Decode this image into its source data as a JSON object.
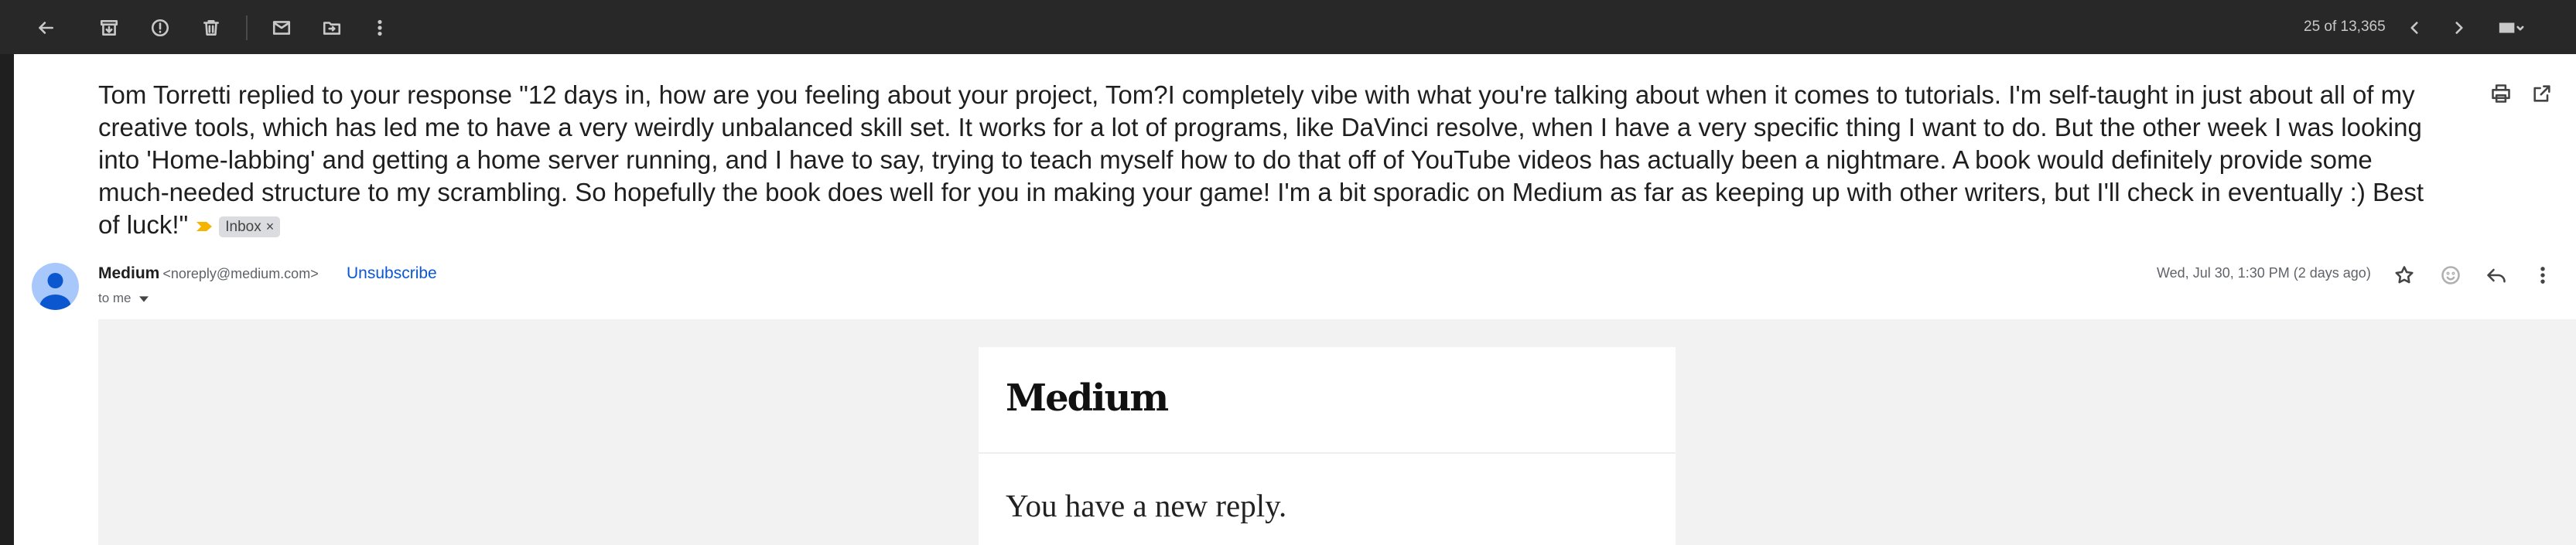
{
  "toolbar": {
    "icons": [
      "back-arrow-icon",
      "archive-icon",
      "report-spam-icon",
      "delete-icon",
      "mark-unread-icon",
      "move-to-icon",
      "more-vert-icon"
    ],
    "counter": "25 of 13,365",
    "nav_icons": [
      "chevron-left-icon",
      "chevron-right-icon",
      "keyboard-icon"
    ]
  },
  "email": {
    "subject": "Tom Torretti replied to your response \"12 days in, how are you feeling about your project, Tom?I completely vibe with what you're talking about when it comes to tutorials. I'm self-taught in just about all of my creative tools, which has led me to have a very weirdly unbalanced skill set. It works for a lot of programs, like DaVinci resolve, when I have a very specific thing I want to do. But the other week I was looking into 'Home-labbing' and getting a home server running, and I have to say, trying to teach myself how to do that off of YouTube videos has actually been a nightmare. A book would definitely provide some much-needed structure to my scrambling. So hopefully the book does well for you in making your game! I'm a bit sporadic on Medium as far as keeping up with other writers, but I'll check in eventually :) Best of luck!\"",
    "label": "Inbox",
    "label_close": "×",
    "sender_name": "Medium",
    "sender_email": "<noreply@medium.com>",
    "unsubscribe": "Unsubscribe",
    "to": "to me",
    "date": "Wed, Jul 30, 1:30 PM (2 days ago)",
    "colors": {
      "important": "#f4b400",
      "link": "#0b57d0",
      "avatar": "#a8c7fa"
    }
  },
  "message_body": {
    "logo": "Medium",
    "heading": "You have a new reply."
  }
}
